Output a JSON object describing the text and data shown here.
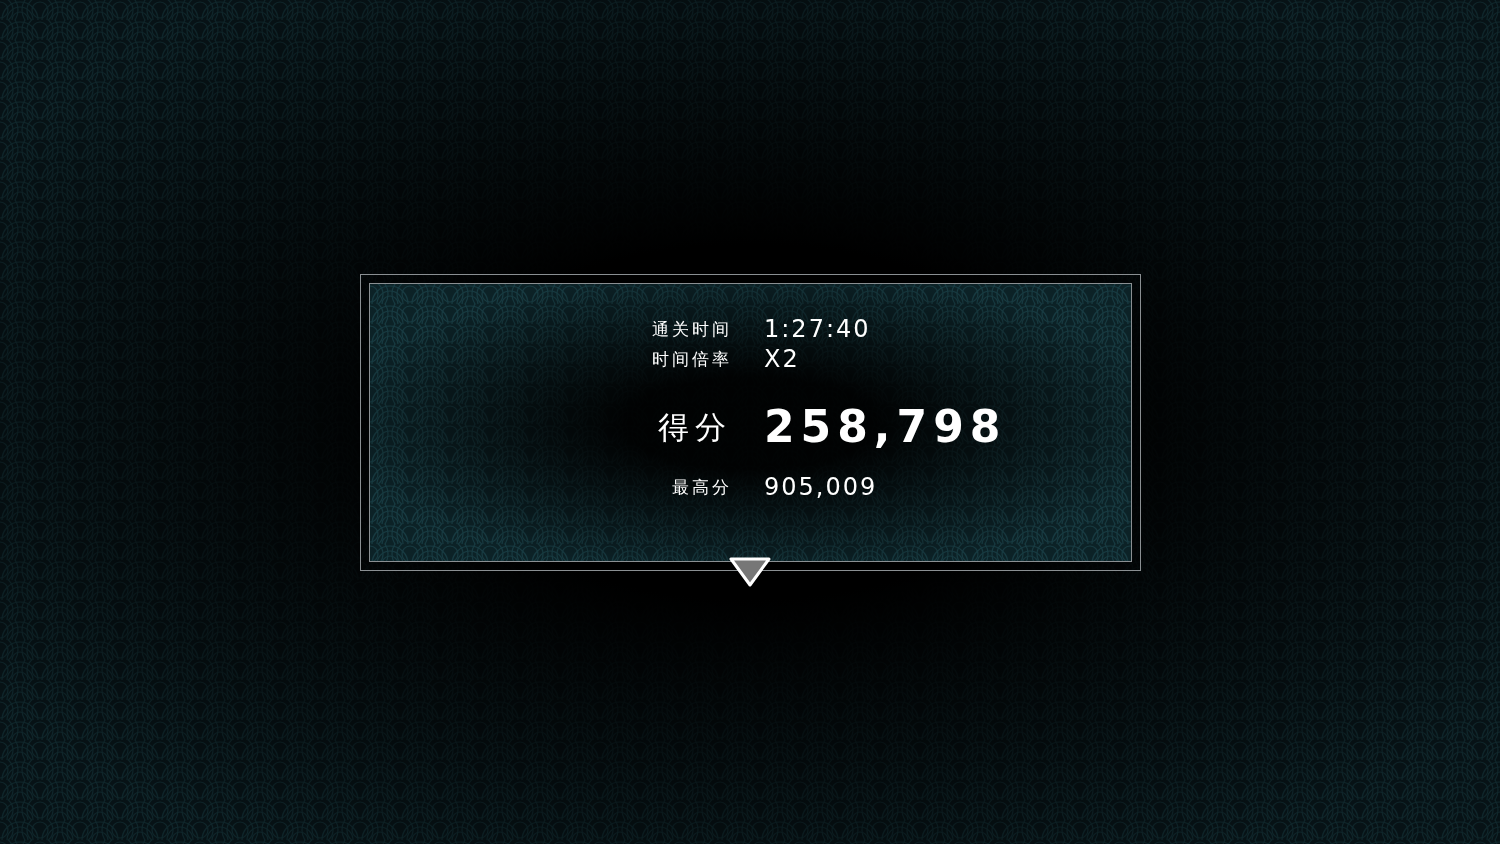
{
  "results": [
    {
      "kind": "small",
      "label": "通关时间",
      "value": "1:27:40"
    },
    {
      "kind": "small",
      "label": "时间倍率",
      "value": "X2"
    },
    {
      "kind": "score",
      "label": "得分",
      "value": "258,798"
    },
    {
      "kind": "best",
      "label": "最高分",
      "value": "905,009"
    }
  ],
  "continue_indicator": {
    "kind": "down"
  }
}
